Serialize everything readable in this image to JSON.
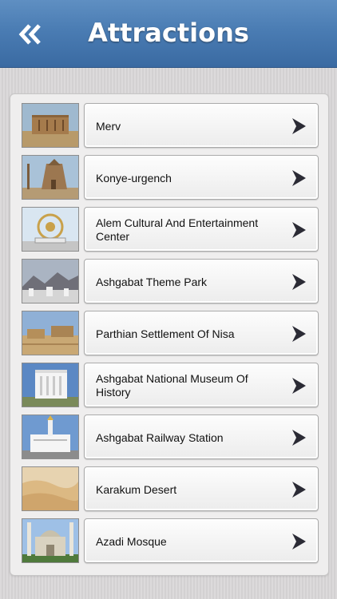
{
  "header": {
    "title": "Attractions",
    "back_icon": "double-chevron-left-icon"
  },
  "items": [
    {
      "label": "Merv",
      "thumb": "merv-fortress"
    },
    {
      "label": "Konye-urgench",
      "thumb": "mausoleum"
    },
    {
      "label": "Alem Cultural And Entertainment Center",
      "thumb": "ferris-wheel"
    },
    {
      "label": "Ashgabat Theme Park",
      "thumb": "city-mountains"
    },
    {
      "label": "Parthian Settlement Of Nisa",
      "thumb": "ruins"
    },
    {
      "label": "Ashgabat National Museum Of History",
      "thumb": "museum"
    },
    {
      "label": "Ashgabat Railway Station",
      "thumb": "station"
    },
    {
      "label": "Karakum Desert",
      "thumb": "desert"
    },
    {
      "label": "Azadi Mosque",
      "thumb": "mosque"
    }
  ],
  "colors": {
    "navbar": "#4a7cb3",
    "panel": "#efeeee",
    "chevron": "#2b2b35"
  }
}
